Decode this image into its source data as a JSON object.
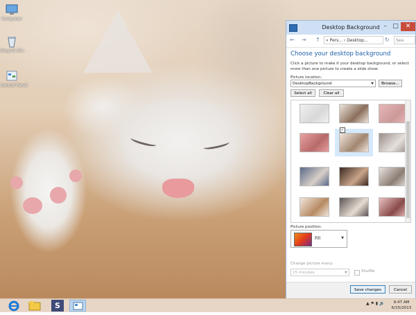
{
  "desktop": {
    "icons": [
      {
        "label": "Computer",
        "icon": "computer-icon"
      },
      {
        "label": "Recycle Bin",
        "icon": "recycle-bin-icon"
      },
      {
        "label": "Control Panel",
        "icon": "control-panel-icon"
      }
    ]
  },
  "dialog": {
    "title": "Desktop Background",
    "address": {
      "back": "←",
      "forward": "→",
      "up": "↑",
      "path": "« Pers... › Desktop...",
      "search_placeholder": "Sea",
      "refresh": "↻"
    },
    "heading": "Choose your desktop background",
    "description": "Click a picture to make it your desktop background, or select more than one picture to create a slide show.",
    "picture_location_label": "Picture location:",
    "picture_location_value": "DesktopBackground",
    "browse_label": "Browse...",
    "select_all_label": "Select all",
    "clear_all_label": "Clear all",
    "picture_position_label": "Picture position:",
    "picture_position_value": "Fill",
    "change_picture_label": "Change picture every:",
    "change_picture_value": "15 minutes",
    "shuffle_label": "Shuffle",
    "save_label": "Save changes",
    "cancel_label": "Cancel",
    "thumbnails": [
      {
        "colors": [
          "#f0f0f0",
          "#d8d8d8"
        ]
      },
      {
        "colors": [
          "#ede3da",
          "#8b6f5c"
        ]
      },
      {
        "colors": [
          "#e7b7b7",
          "#c99"
        ]
      },
      {
        "colors": [
          "#e8a0a0",
          "#b86a6a"
        ]
      },
      {
        "colors": [
          "#f2e6dc",
          "#a08670"
        ],
        "selected": true
      },
      {
        "colors": [
          "#9a8f8a",
          "#e6e0dc"
        ]
      },
      {
        "colors": [
          "#5a6a88",
          "#d8cfc8"
        ]
      },
      {
        "colors": [
          "#3b2a22",
          "#c9a489"
        ]
      },
      {
        "colors": [
          "#e9e3df",
          "#8b7e74"
        ]
      },
      {
        "colors": [
          "#f1e7dd",
          "#b78a62"
        ]
      },
      {
        "colors": [
          "#5b5555",
          "#e6dcd2"
        ]
      },
      {
        "colors": [
          "#e9c1c1",
          "#8a4a4a"
        ]
      }
    ]
  },
  "taskbar": {
    "apps": [
      "ie-icon",
      "file-explorer-icon",
      "s-app-icon",
      "control-panel-icon"
    ],
    "s_letter": "S",
    "time": "9:47 AM",
    "date": "6/15/2013"
  }
}
